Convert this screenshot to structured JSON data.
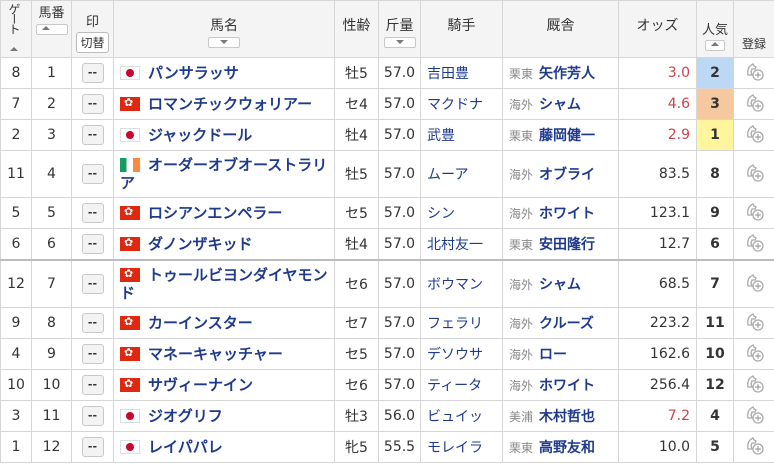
{
  "headers": {
    "gate": "ゲート",
    "umaban": "馬番",
    "mark": "印",
    "kirikae": "切替",
    "name": "馬名",
    "sexage": "性齢",
    "weight": "斤量",
    "jockey": "騎手",
    "trainer": "厩舎",
    "odds": "オッズ",
    "ninki": "人気",
    "touroku": "登録"
  },
  "mark_label": "--",
  "rows": [
    {
      "gate": "8",
      "umaban": "1",
      "flag": "jp",
      "name": "パンサラッサ",
      "sexage": "牡5",
      "weight": "57.0",
      "jockey": "吉田豊",
      "jockey_link": true,
      "region": "栗東",
      "trainer": "矢作芳人",
      "trainer_link": true,
      "odds": "3.0",
      "odds_color": "red",
      "ninki": "2",
      "ninki_class": "n2"
    },
    {
      "gate": "7",
      "umaban": "2",
      "flag": "hk",
      "name": "ロマンチックウォリアー",
      "sexage": "セ4",
      "weight": "57.0",
      "jockey": "マクドナ",
      "jockey_link": true,
      "region": "海外",
      "trainer": "シャム",
      "trainer_link": true,
      "odds": "4.6",
      "odds_color": "red",
      "ninki": "3",
      "ninki_class": "n3"
    },
    {
      "gate": "2",
      "umaban": "3",
      "flag": "jp",
      "name": "ジャックドール",
      "sexage": "牡4",
      "weight": "57.0",
      "jockey": "武豊",
      "jockey_link": true,
      "region": "栗東",
      "trainer": "藤岡健一",
      "trainer_link": true,
      "odds": "2.9",
      "odds_color": "red",
      "ninki": "1",
      "ninki_class": "n1"
    },
    {
      "gate": "11",
      "umaban": "4",
      "flag": "ie",
      "name": "オーダーオブオーストラリア",
      "sexage": "牡5",
      "weight": "57.0",
      "jockey": "ムーア",
      "jockey_link": true,
      "region": "海外",
      "trainer": "オブライ",
      "trainer_link": true,
      "odds": "83.5",
      "odds_color": "black",
      "ninki": "8",
      "ninki_class": ""
    },
    {
      "gate": "5",
      "umaban": "5",
      "flag": "hk",
      "name": "ロシアンエンペラー",
      "sexage": "セ5",
      "weight": "57.0",
      "jockey": "シン",
      "jockey_link": true,
      "region": "海外",
      "trainer": "ホワイト",
      "trainer_link": true,
      "odds": "123.1",
      "odds_color": "black",
      "ninki": "9",
      "ninki_class": ""
    },
    {
      "gate": "6",
      "umaban": "6",
      "flag": "hk",
      "name": "ダノンザキッド",
      "sexage": "牡4",
      "weight": "57.0",
      "jockey": "北村友一",
      "jockey_link": true,
      "region": "栗東",
      "trainer": "安田隆行",
      "trainer_link": true,
      "odds": "12.7",
      "odds_color": "black",
      "ninki": "6",
      "ninki_class": ""
    },
    {
      "gate": "12",
      "umaban": "7",
      "flag": "hk",
      "name": "トゥールビヨンダイヤモンド",
      "sexage": "セ6",
      "weight": "57.0",
      "jockey": "ボウマン",
      "jockey_link": true,
      "region": "海外",
      "trainer": "シャム",
      "trainer_link": true,
      "odds": "68.5",
      "odds_color": "black",
      "ninki": "7",
      "ninki_class": ""
    },
    {
      "gate": "9",
      "umaban": "8",
      "flag": "hk",
      "name": "カーインスター",
      "sexage": "セ7",
      "weight": "57.0",
      "jockey": "フェラリ",
      "jockey_link": true,
      "region": "海外",
      "trainer": "クルーズ",
      "trainer_link": true,
      "odds": "223.2",
      "odds_color": "black",
      "ninki": "11",
      "ninki_class": ""
    },
    {
      "gate": "4",
      "umaban": "9",
      "flag": "hk",
      "name": "マネーキャッチャー",
      "sexage": "セ5",
      "weight": "57.0",
      "jockey": "デソウサ",
      "jockey_link": true,
      "region": "海外",
      "trainer": "ロー",
      "trainer_link": true,
      "odds": "162.6",
      "odds_color": "black",
      "ninki": "10",
      "ninki_class": ""
    },
    {
      "gate": "10",
      "umaban": "10",
      "flag": "hk",
      "name": "サヴィーナイン",
      "sexage": "セ6",
      "weight": "57.0",
      "jockey": "ティータ",
      "jockey_link": true,
      "region": "海外",
      "trainer": "ホワイト",
      "trainer_link": true,
      "odds": "256.4",
      "odds_color": "black",
      "ninki": "12",
      "ninki_class": ""
    },
    {
      "gate": "3",
      "umaban": "11",
      "flag": "jp",
      "name": "ジオグリフ",
      "sexage": "牡3",
      "weight": "56.0",
      "jockey": "ビュイッ",
      "jockey_link": true,
      "region": "美浦",
      "trainer": "木村哲也",
      "trainer_link": true,
      "odds": "7.2",
      "odds_color": "red",
      "ninki": "4",
      "ninki_class": ""
    },
    {
      "gate": "1",
      "umaban": "12",
      "flag": "jp",
      "name": "レイパパレ",
      "sexage": "牝5",
      "weight": "55.5",
      "jockey": "モレイラ",
      "jockey_link": true,
      "region": "栗東",
      "trainer": "高野友和",
      "trainer_link": true,
      "odds": "10.0",
      "odds_color": "black",
      "ninki": "5",
      "ninki_class": ""
    }
  ]
}
